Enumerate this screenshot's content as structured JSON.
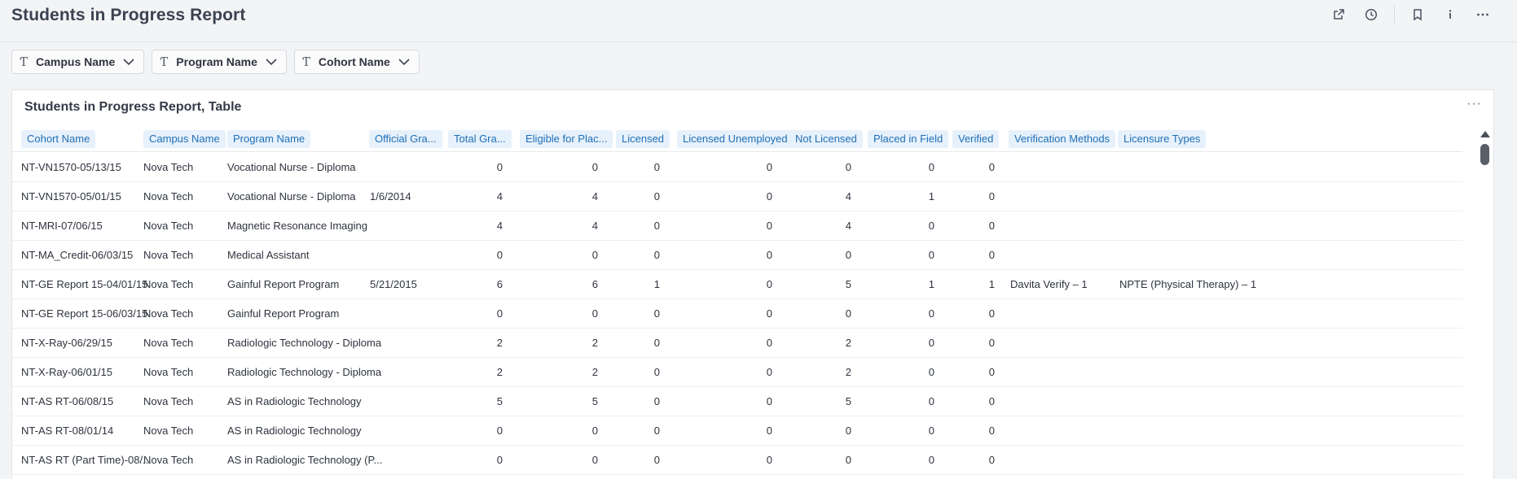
{
  "page": {
    "title": "Students in Progress Report"
  },
  "actions": [
    "external-link-icon",
    "clock-icon",
    "bookmark-icon",
    "info-icon",
    "more-icon"
  ],
  "filters": [
    {
      "label": "Campus Name",
      "icon": "text-type-icon"
    },
    {
      "label": "Program Name",
      "icon": "text-type-icon"
    },
    {
      "label": "Cohort Name",
      "icon": "text-type-icon"
    }
  ],
  "table": {
    "title": "Students in Progress Report, Table",
    "columns": [
      "Cohort Name",
      "Campus Name",
      "Program Name",
      "Official Gra...",
      "Total Gra...",
      "Eligible for Plac...",
      "Licensed",
      "Licensed Unemployed",
      "Not Licensed",
      "Placed in Field",
      "Verified",
      "Verification Methods",
      "Licensure Types"
    ],
    "rows": [
      [
        "NT-VN1570-05/13/15",
        "Nova Tech",
        "Vocational Nurse - Diploma",
        "",
        "0",
        "0",
        "0",
        "0",
        "0",
        "0",
        "0",
        "",
        ""
      ],
      [
        "NT-VN1570-05/01/15",
        "Nova Tech",
        "Vocational Nurse - Diploma",
        "1/6/2014",
        "4",
        "4",
        "0",
        "0",
        "4",
        "1",
        "0",
        "",
        ""
      ],
      [
        "NT-MRI-07/06/15",
        "Nova Tech",
        "Magnetic Resonance Imaging",
        "",
        "4",
        "4",
        "0",
        "0",
        "4",
        "0",
        "0",
        "",
        ""
      ],
      [
        "NT-MA_Credit-06/03/15",
        "Nova Tech",
        "Medical Assistant",
        "",
        "0",
        "0",
        "0",
        "0",
        "0",
        "0",
        "0",
        "",
        ""
      ],
      [
        "NT-GE Report 15-04/01/15",
        "Nova Tech",
        "Gainful Report Program",
        "5/21/2015",
        "6",
        "6",
        "1",
        "0",
        "5",
        "1",
        "1",
        "Davita Verify – 1",
        "NPTE (Physical Therapy) – 1"
      ],
      [
        "NT-GE Report 15-06/03/15",
        "Nova Tech",
        "Gainful Report Program",
        "",
        "0",
        "0",
        "0",
        "0",
        "0",
        "0",
        "0",
        "",
        ""
      ],
      [
        "NT-X-Ray-06/29/15",
        "Nova Tech",
        "Radiologic Technology - Diploma",
        "",
        "2",
        "2",
        "0",
        "0",
        "2",
        "0",
        "0",
        "",
        ""
      ],
      [
        "NT-X-Ray-06/01/15",
        "Nova Tech",
        "Radiologic Technology - Diploma",
        "",
        "2",
        "2",
        "0",
        "0",
        "2",
        "0",
        "0",
        "",
        ""
      ],
      [
        "NT-AS RT-06/08/15",
        "Nova Tech",
        "AS in Radiologic Technology",
        "",
        "5",
        "5",
        "0",
        "0",
        "5",
        "0",
        "0",
        "",
        ""
      ],
      [
        "NT-AS RT-08/01/14",
        "Nova Tech",
        "AS in Radiologic Technology",
        "",
        "0",
        "0",
        "0",
        "0",
        "0",
        "0",
        "0",
        "",
        ""
      ],
      [
        "NT-AS RT (Part Time)-08/...",
        "Nova Tech",
        "AS in Radiologic Technology (P...",
        "",
        "0",
        "0",
        "0",
        "0",
        "0",
        "0",
        "0",
        "",
        ""
      ]
    ]
  }
}
